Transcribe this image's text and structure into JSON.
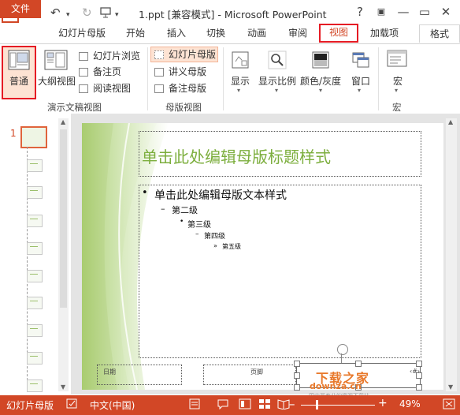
{
  "title_bar": {
    "title": "1.ppt [兼容模式] - Microsoft PowerPoint",
    "help": "?",
    "minimize": "—",
    "restore": "▭",
    "close": "✕"
  },
  "quick_access": {
    "save_icon": "save-icon",
    "undo_icon": "undo-icon",
    "redo_icon": "redo-icon",
    "slideshow_icon": "slideshow-icon"
  },
  "tabs": [
    {
      "label": "文件"
    },
    {
      "label": "幻灯片母版"
    },
    {
      "label": "开始"
    },
    {
      "label": "插入"
    },
    {
      "label": "切换"
    },
    {
      "label": "动画"
    },
    {
      "label": "审阅"
    },
    {
      "label": "视图"
    },
    {
      "label": "加载项"
    },
    {
      "label": "格式"
    }
  ],
  "ribbon": {
    "presentation_views": {
      "label": "演示文稿视图",
      "normal": "普通",
      "outline": "大纲视图",
      "slide_sorter": "幻灯片浏览",
      "notes_page": "备注页",
      "reading_view": "阅读视图"
    },
    "master_views": {
      "label": "母版视图",
      "slide_master": "幻灯片母版",
      "handout_master": "讲义母版",
      "notes_master": "备注母版"
    },
    "show": "显示",
    "zoom": "显示比例",
    "color": "颜色/灰度",
    "window": "窗口",
    "macros": {
      "label": "宏",
      "button": "宏"
    }
  },
  "thumbnails": {
    "selected_number": "1"
  },
  "slide": {
    "title": "单击此处编辑母版标题样式",
    "body_l1": "单击此处编辑母版文本样式",
    "body_l2": "第二级",
    "body_l3": "第三级",
    "body_l4": "第四级",
    "body_l5": "第五级",
    "bullet_l1": "•",
    "bullet_l2": "–",
    "bullet_l3": "•",
    "bullet_l4": "–",
    "bullet_l5": "»",
    "date": "日期",
    "footer": "页脚",
    "slide_number": "‹#›"
  },
  "watermark": {
    "main": "下载之家",
    "domain": "downza.cn",
    "slogan": "国内最专业的资源下载站"
  },
  "status_bar": {
    "view_name": "幻灯片母版",
    "language": "中文(中国)",
    "zoom_percent": "49%",
    "zoom_level": 0.49
  },
  "colors": {
    "accent": "#d24726",
    "title_green": "#7cae3d",
    "highlight_red": "#e51b24"
  }
}
